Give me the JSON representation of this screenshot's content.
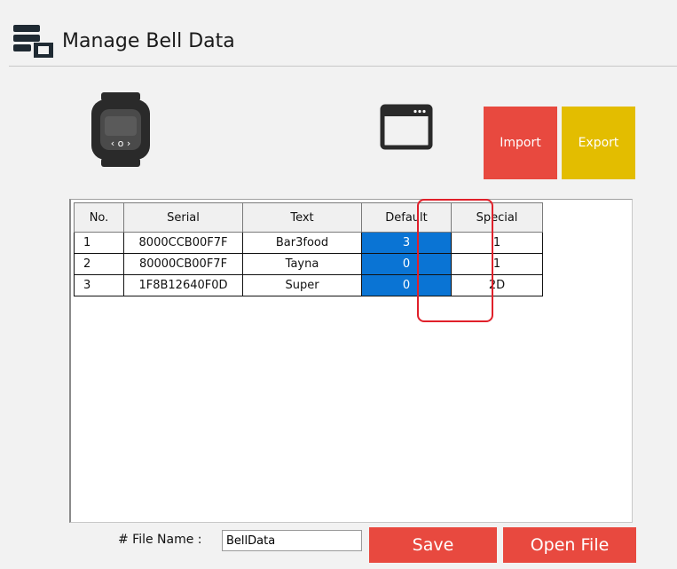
{
  "header": {
    "title": "Manage Bell Data",
    "icon": "database-settings-icon"
  },
  "toolbar": {
    "watch_icon": "smartwatch-icon",
    "window_icon": "window-icon",
    "import_label": "Import",
    "export_label": "Export",
    "import_color": "#e8493f",
    "export_color": "#e3bd00"
  },
  "table": {
    "columns": [
      "No.",
      "Serial",
      "Text",
      "Default",
      "Special"
    ],
    "rows": [
      {
        "no": "1",
        "serial": "8000CCB00F7F",
        "text": "Bar3food",
        "default": "3",
        "special": "1"
      },
      {
        "no": "2",
        "serial": "80000CB00F7F",
        "text": "Tayna",
        "default": "0",
        "special": "1"
      },
      {
        "no": "3",
        "serial": "1F8B12640F0D",
        "text": "Super",
        "default": "0",
        "special": "2D"
      }
    ],
    "selected_column_color": "#0a74d4",
    "highlight_color": "#e0202a"
  },
  "footer": {
    "file_label": "# File Name :",
    "file_value": "BellData",
    "save_label": "Save",
    "open_label": "Open File"
  }
}
